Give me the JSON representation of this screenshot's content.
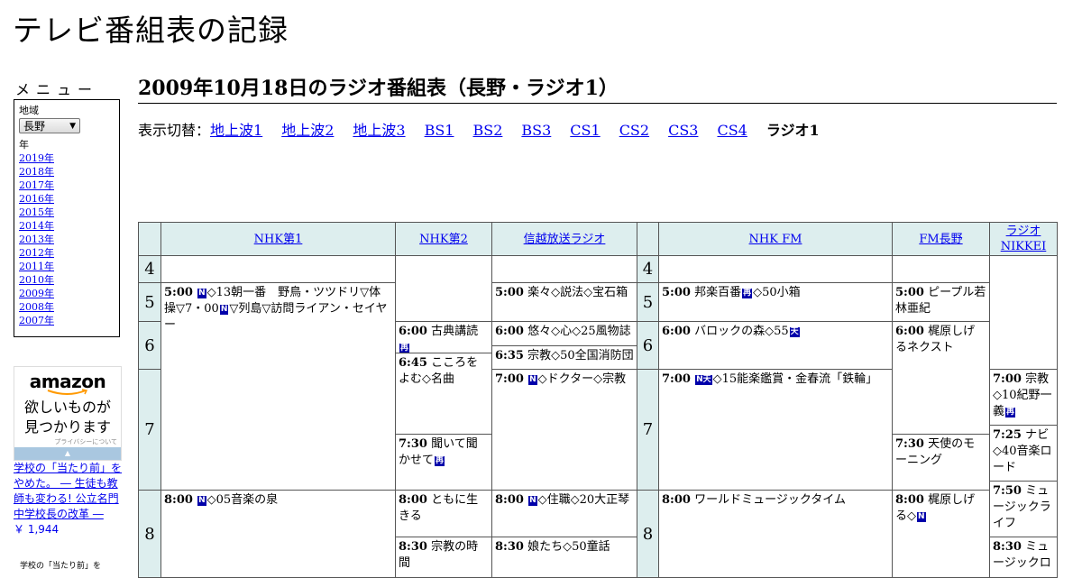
{
  "site_title": "テレビ番組表の記録",
  "menu": {
    "heading": "メニュー",
    "region_label": "地域",
    "region_value": "長野",
    "year_label": "年",
    "years": [
      "2019年",
      "2018年",
      "2017年",
      "2016年",
      "2015年",
      "2014年",
      "2013年",
      "2012年",
      "2011年",
      "2010年",
      "2009年",
      "2008年",
      "2007年"
    ]
  },
  "ad": {
    "logo": "amazon",
    "copy_line1": "欲しいものが",
    "copy_line2": "見つかります",
    "privacy": "プライバシーについて"
  },
  "book": {
    "title": "学校の「当たり前」をやめた。 ― 生徒も教師も変わる! 公立名門中学校長の改革 ―",
    "price": "￥ 1,944",
    "thumb_text": "学校の「当たり前」を"
  },
  "page_heading": "2009年10月18日のラジオ番組表（長野・ラジオ1）",
  "switcher": {
    "label": "表示切替：",
    "links": [
      "地上波1",
      "地上波2",
      "地上波3",
      "BS1",
      "BS2",
      "BS3",
      "CS1",
      "CS2",
      "CS3",
      "CS4"
    ],
    "current": "ラジオ1"
  },
  "channels": [
    "NHK第1",
    "NHK第2",
    "信越放送ラジオ",
    "NHK FM",
    "FM長野",
    "ラジオNIKKEI"
  ],
  "hours": [
    "4",
    "5",
    "6",
    "7",
    "8"
  ],
  "programs": [
    {
      "ch": "NHK第1",
      "time": "5:00",
      "pre": "",
      "mark": "N",
      "text": "◇13朝一番　野鳥・ツツドリ▽体操▽7・00",
      "mark2": "N",
      "text2": "▽列島▽訪問ライアン・セイヤー"
    },
    {
      "ch": "NHK第1",
      "time": "8:00",
      "pre": "",
      "mark": "N",
      "text": "◇05音楽の泉",
      "mark2": "",
      "text2": ""
    },
    {
      "ch": "NHK第2",
      "time": "6:00",
      "pre": "古典講読",
      "mark": "再",
      "text": "",
      "mark2": "",
      "text2": ""
    },
    {
      "ch": "NHK第2",
      "time": "6:45",
      "pre": "こころをよむ◇名曲",
      "mark": "",
      "text": "",
      "mark2": "",
      "text2": ""
    },
    {
      "ch": "NHK第2",
      "time": "7:30",
      "pre": "聞いて聞かせて",
      "mark": "再",
      "text": "",
      "mark2": "",
      "text2": ""
    },
    {
      "ch": "NHK第2",
      "time": "8:00",
      "pre": "ともに生きる",
      "mark": "",
      "text": "",
      "mark2": "",
      "text2": ""
    },
    {
      "ch": "NHK第2",
      "time": "8:30",
      "pre": "宗教の時間",
      "mark": "",
      "text": "",
      "mark2": "",
      "text2": ""
    },
    {
      "ch": "信越放送ラジオ",
      "time": "5:00",
      "pre": "楽々◇説法◇宝石箱",
      "mark": "",
      "text": "",
      "mark2": "",
      "text2": ""
    },
    {
      "ch": "信越放送ラジオ",
      "time": "6:00",
      "pre": "悠々◇心◇25風物誌",
      "mark": "",
      "text": "",
      "mark2": "",
      "text2": ""
    },
    {
      "ch": "信越放送ラジオ",
      "time": "6:35",
      "pre": "宗教◇50全国消防団",
      "mark": "",
      "text": "",
      "mark2": "",
      "text2": ""
    },
    {
      "ch": "信越放送ラジオ",
      "time": "7:00",
      "pre": "",
      "mark": "N",
      "text": "◇ドクター◇宗教",
      "mark2": "",
      "text2": ""
    },
    {
      "ch": "信越放送ラジオ",
      "time": "8:00",
      "pre": "",
      "mark": "N",
      "text": "◇住職◇20大正琴",
      "mark2": "",
      "text2": ""
    },
    {
      "ch": "信越放送ラジオ",
      "time": "8:30",
      "pre": "娘たち◇50童話",
      "mark": "",
      "text": "",
      "mark2": "",
      "text2": ""
    },
    {
      "ch": "NHK FM",
      "time": "5:00",
      "pre": "邦楽百番",
      "mark": "再",
      "text": "◇50小箱",
      "mark2": "",
      "text2": ""
    },
    {
      "ch": "NHK FM",
      "time": "6:00",
      "pre": "バロックの森◇55",
      "mark": "天",
      "text": "",
      "mark2": "",
      "text2": ""
    },
    {
      "ch": "NHK FM",
      "time": "7:00",
      "pre": "",
      "mark": "N天",
      "text": "◇15能楽鑑賞・金春流「鉄輪」",
      "mark2": "",
      "text2": ""
    },
    {
      "ch": "NHK FM",
      "time": "8:00",
      "pre": "ワールドミュージックタイム",
      "mark": "",
      "text": "",
      "mark2": "",
      "text2": ""
    },
    {
      "ch": "FM長野",
      "time": "5:00",
      "pre": "ピープル若林亜紀",
      "mark": "",
      "text": "",
      "mark2": "",
      "text2": ""
    },
    {
      "ch": "FM長野",
      "time": "6:00",
      "pre": "梶原しげるネクスト",
      "mark": "",
      "text": "",
      "mark2": "",
      "text2": ""
    },
    {
      "ch": "FM長野",
      "time": "7:30",
      "pre": "天使のモーニング",
      "mark": "",
      "text": "",
      "mark2": "",
      "text2": ""
    },
    {
      "ch": "FM長野",
      "time": "8:00",
      "pre": "梶原しげる◇",
      "mark": "N",
      "text": "",
      "mark2": "",
      "text2": ""
    },
    {
      "ch": "ラジオNIKKEI",
      "time": "7:00",
      "pre": "宗教◇10紀野一義",
      "mark": "再",
      "text": "",
      "mark2": "",
      "text2": ""
    },
    {
      "ch": "ラジオNIKKEI",
      "time": "7:25",
      "pre": "ナビ◇40音楽ロード",
      "mark": "",
      "text": "",
      "mark2": "",
      "text2": ""
    },
    {
      "ch": "ラジオNIKKEI",
      "time": "7:50",
      "pre": "ミュージックライフ",
      "mark": "",
      "text": "",
      "mark2": "",
      "text2": ""
    },
    {
      "ch": "ラジオNIKKEI",
      "time": "8:30",
      "pre": "ミュージックロ",
      "mark": "",
      "text": "",
      "mark2": "",
      "text2": ""
    }
  ],
  "colors": {
    "header_bg": "#ddeeee",
    "link": "#0000ee",
    "mark_bg": "#0000aa"
  }
}
